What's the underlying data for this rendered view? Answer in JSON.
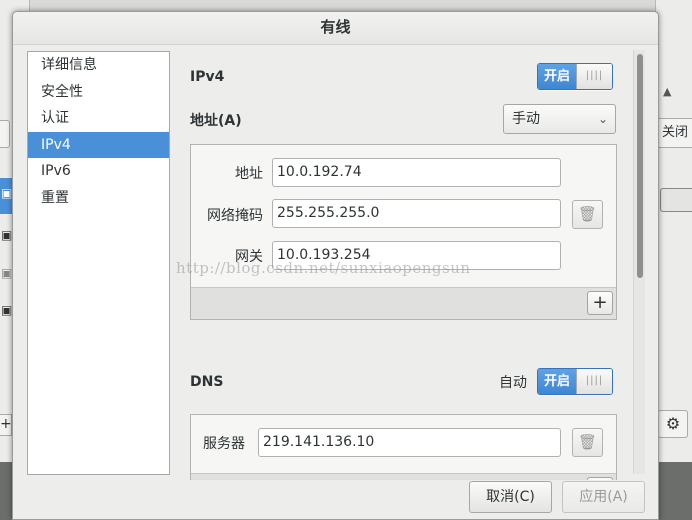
{
  "background": {
    "right_button_label": "关闭"
  },
  "dialog": {
    "title": "有线",
    "sidebar": {
      "items": [
        {
          "label": "详细信息",
          "selected": false
        },
        {
          "label": "安全性",
          "selected": false
        },
        {
          "label": "认证",
          "selected": false
        },
        {
          "label": "IPv4",
          "selected": true
        },
        {
          "label": "IPv6",
          "selected": false
        },
        {
          "label": "重置",
          "selected": false
        }
      ]
    },
    "ipv4": {
      "title": "IPv4",
      "switch_label": "开启",
      "switch_on": true
    },
    "address": {
      "title": "地址(A)",
      "method": "手动",
      "rows": [
        {
          "label": "地址",
          "value": "10.0.192.74"
        },
        {
          "label": "网络掩码",
          "value": "255.255.255.0"
        },
        {
          "label": "网关",
          "value": "10.0.193.254"
        }
      ],
      "add_label": "+"
    },
    "dns": {
      "title": "DNS",
      "auto_label": "自动",
      "switch_label": "开启",
      "switch_on": true,
      "server_label": "服务器",
      "server_value": "219.141.136.10"
    },
    "buttons": {
      "cancel": "取消(C)",
      "apply": "应用(A)"
    }
  },
  "watermark": "http://blog.csdn.net/sunxiaopengsun",
  "colors": {
    "accent": "#4a90d9",
    "window_bg": "#ededec"
  }
}
